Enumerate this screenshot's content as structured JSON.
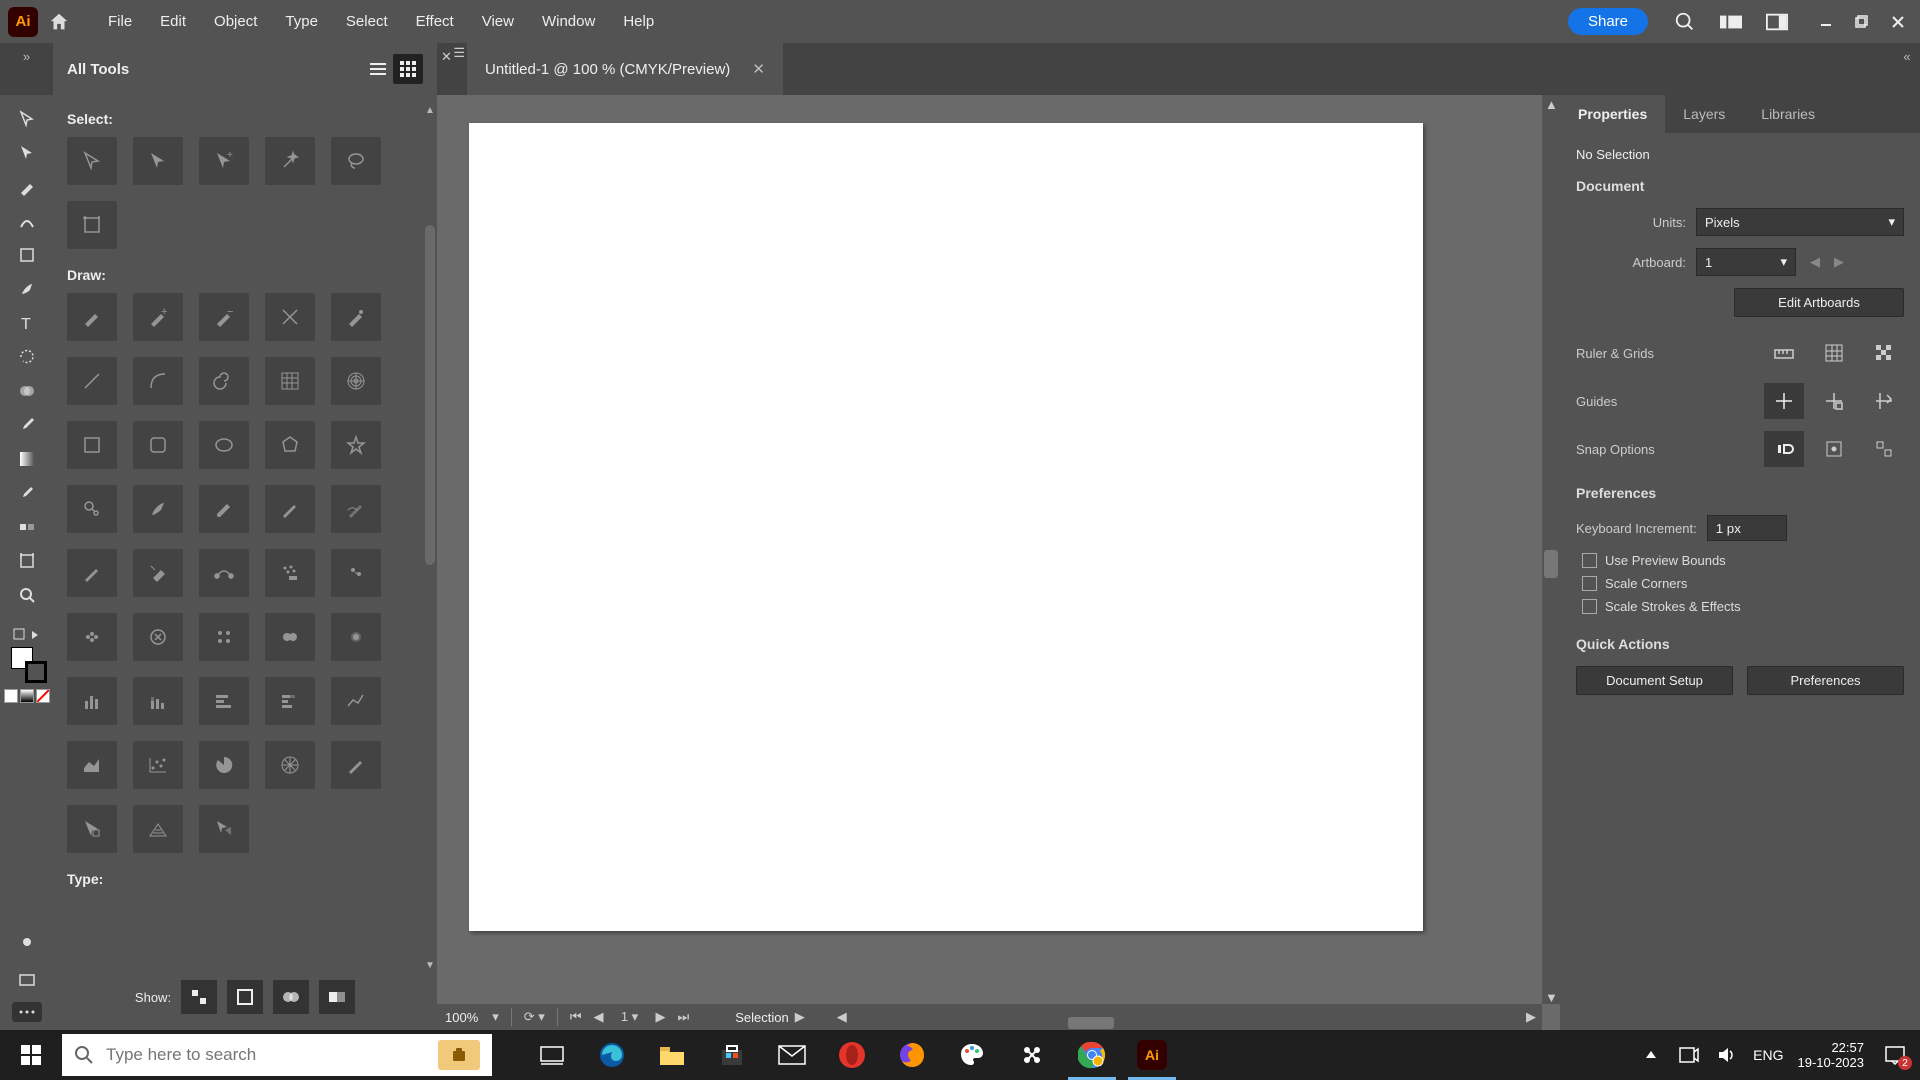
{
  "menubar": {
    "items": [
      "File",
      "Edit",
      "Object",
      "Type",
      "Select",
      "Effect",
      "View",
      "Window",
      "Help"
    ],
    "share": "Share"
  },
  "tab": {
    "title": "Untitled-1 @ 100 % (CMYK/Preview)"
  },
  "alltools": {
    "title": "All Tools",
    "sections": {
      "select": "Select:",
      "draw": "Draw:",
      "type": "Type:"
    },
    "show": "Show:"
  },
  "status": {
    "zoom": "100%",
    "tool": "Selection"
  },
  "rp": {
    "tabs": [
      "Properties",
      "Layers",
      "Libraries"
    ],
    "noSelection": "No Selection",
    "document": "Document",
    "units_lbl": "Units:",
    "units_val": "Pixels",
    "artboard_lbl": "Artboard:",
    "artboard_val": "1",
    "editArtboards": "Edit Artboards",
    "rulerGrids": "Ruler & Grids",
    "guides": "Guides",
    "snap": "Snap Options",
    "prefs": "Preferences",
    "kbdInc_lbl": "Keyboard Increment:",
    "kbdInc_val": "1 px",
    "cb1": "Use Preview Bounds",
    "cb2": "Scale Corners",
    "cb3": "Scale Strokes & Effects",
    "quick": "Quick Actions",
    "docSetup": "Document Setup",
    "prefBtn": "Preferences"
  },
  "taskbar": {
    "searchPlaceholder": "Type here to search",
    "lang": "ENG",
    "time": "22:57",
    "date": "19-10-2023",
    "notif": "2"
  }
}
